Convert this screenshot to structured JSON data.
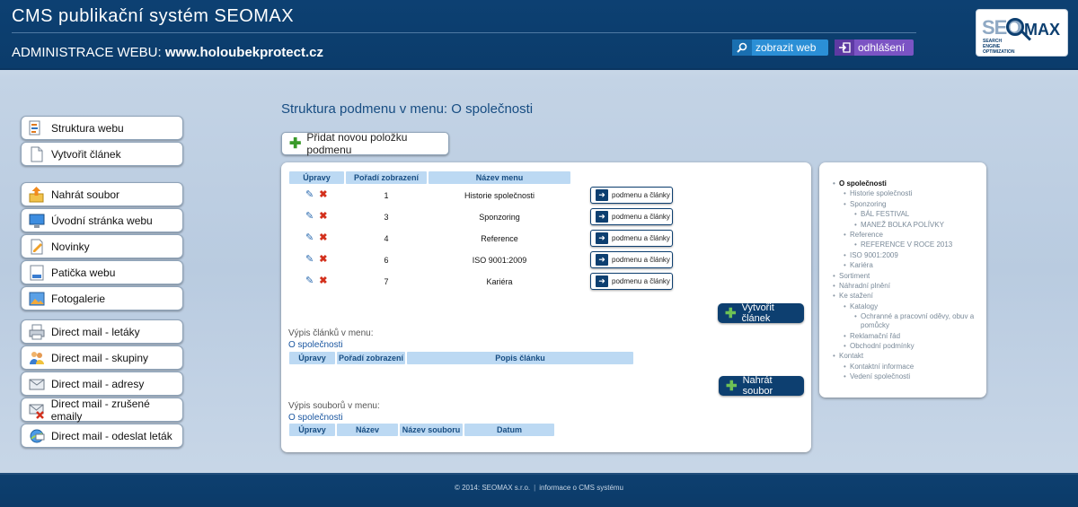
{
  "header": {
    "title": "CMS publikační systém SEOMAX",
    "admin_prefix": "ADMINISTRACE WEBU:",
    "domain": "www.holoubekprotect.cz",
    "view_label": "zobrazit web",
    "logout_label": "odhlášení",
    "logo": {
      "seo": "SEO",
      "max": "MAX",
      "sub1": "SEARCH",
      "sub2": "ENGINE",
      "sub3": "OPTIMIZATION"
    }
  },
  "sidebar": {
    "groups": [
      [
        {
          "label": "Struktura webu",
          "icon": "structure-icon"
        },
        {
          "label": "Vytvořit článek",
          "icon": "document-icon"
        }
      ],
      [
        {
          "label": "Nahrát soubor",
          "icon": "upload-icon"
        },
        {
          "label": "Úvodní stránka webu",
          "icon": "monitor-icon"
        },
        {
          "label": "Novinky",
          "icon": "news-icon"
        },
        {
          "label": "Patička webu",
          "icon": "footer-icon"
        },
        {
          "label": "Fotogalerie",
          "icon": "gallery-icon"
        }
      ],
      [
        {
          "label": "Direct mail - letáky",
          "icon": "printer-icon"
        },
        {
          "label": "Direct mail - skupiny",
          "icon": "group-icon"
        },
        {
          "label": "Direct mail - adresy",
          "icon": "envelope-icon"
        },
        {
          "label": "Direct mail - zrušené emaily",
          "icon": "envelope-delete-icon"
        },
        {
          "label": "Direct mail - odeslat leták",
          "icon": "globe-send-icon"
        }
      ]
    ]
  },
  "main": {
    "title": "Struktura podmenu v menu: O společnosti",
    "add_button": "Přidat novou položku podmenu",
    "submenu_table": {
      "headers": [
        "Úpravy",
        "Pořadí zobrazení",
        "Název menu"
      ],
      "rows": [
        {
          "order": "1",
          "name": "Historie společnosti",
          "action": "podmenu a články"
        },
        {
          "order": "3",
          "name": "Sponzoring",
          "action": "podmenu a články"
        },
        {
          "order": "4",
          "name": "Reference",
          "action": "podmenu a články"
        },
        {
          "order": "6",
          "name": "ISO 9001:2009",
          "action": "podmenu a články"
        },
        {
          "order": "7",
          "name": "Kariéra",
          "action": "podmenu a články"
        }
      ]
    },
    "create_article_button": "Vytvořit článek",
    "articles": {
      "label": "Výpis článků v menu:",
      "menu": "O společnosti",
      "headers": [
        "Úpravy",
        "Pořadí zobrazení",
        "Popis článku"
      ]
    },
    "upload_button": "Nahrát soubor",
    "files": {
      "label": "Výpis souborů v menu:",
      "menu": "O společnosti",
      "headers": [
        "Úpravy",
        "Název",
        "Název souboru",
        "Datum"
      ]
    }
  },
  "tree": [
    {
      "label": "O společnosti",
      "level": 0,
      "active": true
    },
    {
      "label": "Historie společnosti",
      "level": 1
    },
    {
      "label": "Sponzoring",
      "level": 1
    },
    {
      "label": "BÁL FESTIVAL",
      "level": 2
    },
    {
      "label": "MANEŽ BOLKA POLÍVKY",
      "level": 2
    },
    {
      "label": "Reference",
      "level": 1
    },
    {
      "label": "REFERENCE V ROCE 2013",
      "level": 2
    },
    {
      "label": "ISO 9001:2009",
      "level": 1
    },
    {
      "label": "Kariéra",
      "level": 1
    },
    {
      "label": "Sortiment",
      "level": 0
    },
    {
      "label": "Náhradní plnění",
      "level": 0
    },
    {
      "label": "Ke stažení",
      "level": 0
    },
    {
      "label": "Katalogy",
      "level": 1
    },
    {
      "label": "Ochranné a pracovní oděvy, obuv a pomůcky",
      "level": 2
    },
    {
      "label": "Reklamační řád",
      "level": 1
    },
    {
      "label": "Obchodní podmínky",
      "level": 1
    },
    {
      "label": "Kontakt",
      "level": 0
    },
    {
      "label": "Kontaktní informace",
      "level": 1
    },
    {
      "label": "Vedení společnosti",
      "level": 1
    }
  ],
  "footer": {
    "copyright": "© 2014: SEOMAX s.r.o.",
    "info_link": "informace o CMS systému"
  }
}
